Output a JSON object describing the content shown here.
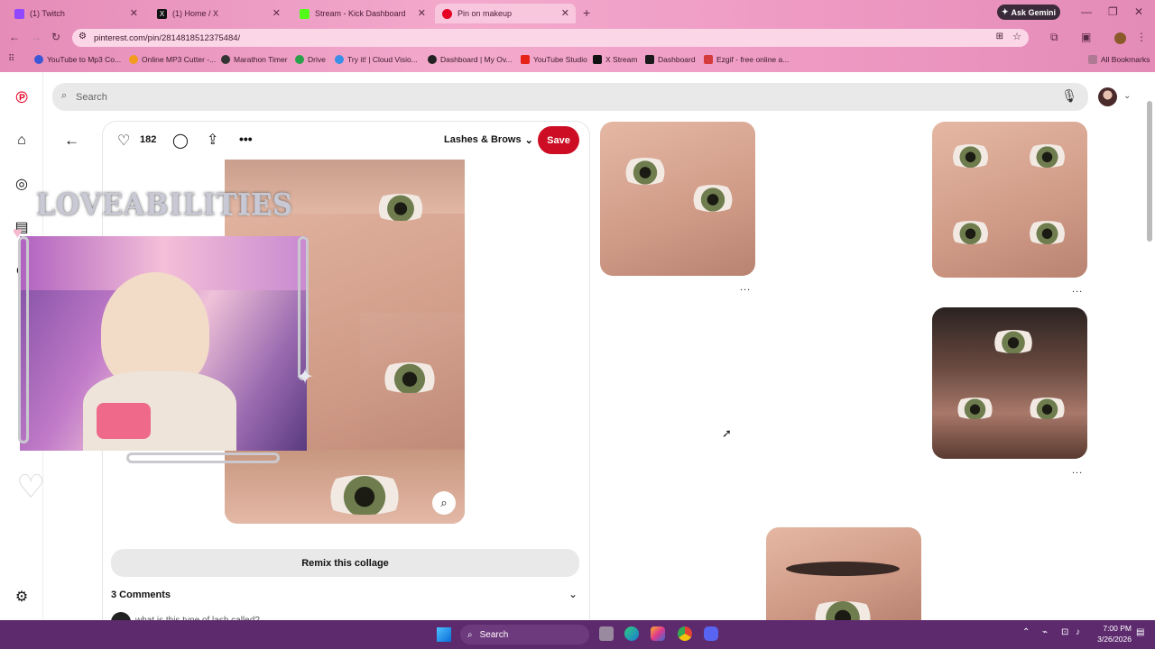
{
  "browser": {
    "tabs": [
      {
        "label": "(1) Twitch",
        "color": "#9146ff"
      },
      {
        "label": "(1) Home / X",
        "color": "#111111"
      },
      {
        "label": "Stream - Kick Dashboard",
        "color": "#53fc18"
      },
      {
        "label": "Pin on makeup",
        "color": "#e60023"
      }
    ],
    "ask_gemini": "Ask Gemini",
    "url": "pinterest.com/pin/2814818512375484/",
    "bookmarks": [
      "YouTube to Mp3 Co...",
      "Online MP3 Cutter -...",
      "Marathon Timer",
      "Drive",
      "Try it! | Cloud Visio...",
      "Dashboard | My Ov...",
      "YouTube Studio",
      "X Stream",
      "Dashboard",
      "Ezgif - free online a..."
    ],
    "all_bookmarks": "All Bookmarks"
  },
  "pinterest": {
    "search_placeholder": "Search",
    "likes": "182",
    "board_name": "Lashes & Brows",
    "save_label": "Save",
    "remix_label": "Remix this collage",
    "comments_header": "3 Comments",
    "first_comment": "what is this type of lash called?",
    "more_dots": "..."
  },
  "overlay": {
    "title": "LOVEABILITIES"
  },
  "taskbar": {
    "search": "Search",
    "time": "7:00 PM",
    "date": "3/26/2026"
  }
}
